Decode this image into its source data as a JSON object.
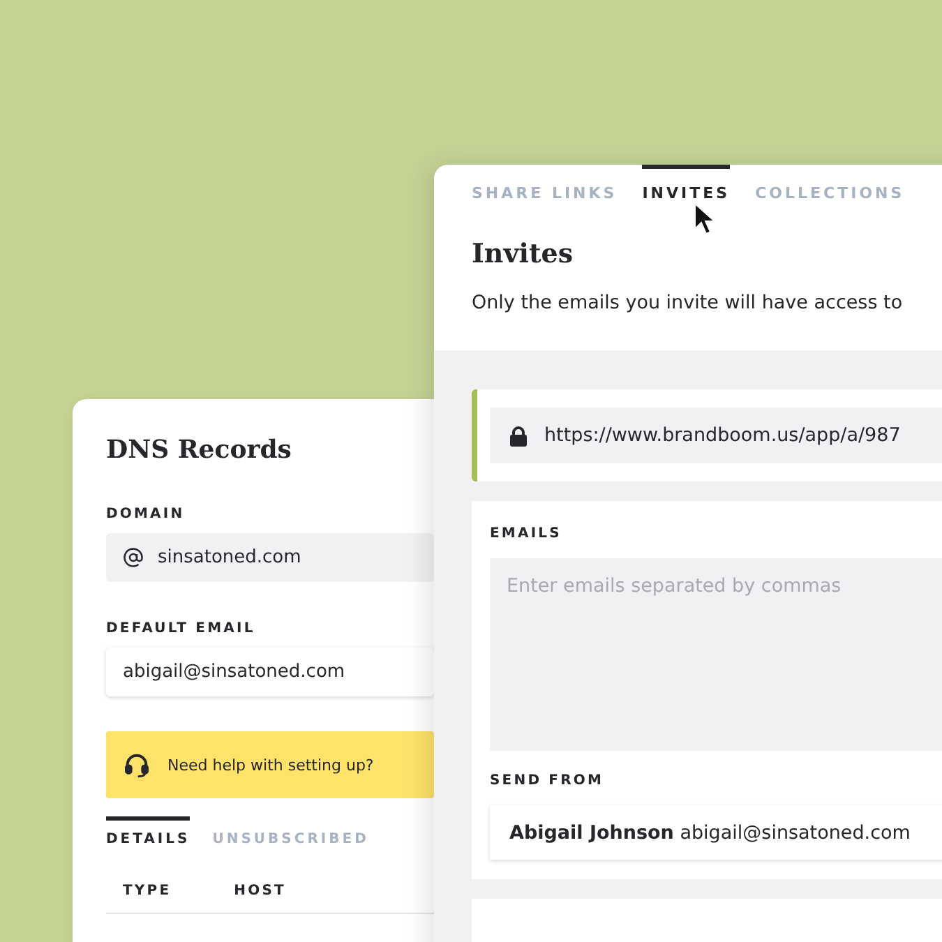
{
  "dns_card": {
    "title": "DNS Records",
    "domain": {
      "label": "DOMAIN",
      "value": "sinsatoned.com"
    },
    "default_email": {
      "label": "DEFAULT EMAIL",
      "value": "abigail@sinsatoned.com"
    },
    "help_banner": "Need help with setting up?",
    "tabs": [
      {
        "label": "DETAILS",
        "selected": true
      },
      {
        "label": "UNSUBSCRIBED",
        "selected": false
      }
    ],
    "table": {
      "columns": [
        "TYPE",
        "HOST"
      ]
    }
  },
  "share_card": {
    "tabs": [
      {
        "label": "SHARE LINKS",
        "selected": false
      },
      {
        "label": "INVITES",
        "selected": true
      },
      {
        "label": "COLLECTIONS",
        "selected": false
      }
    ],
    "title": "Invites",
    "description": "Only the emails you invite will have access to",
    "link": "https://www.brandboom.us/app/a/987",
    "emails": {
      "label": "EMAILS",
      "placeholder": "Enter emails separated by commas"
    },
    "send_from": {
      "label": "SEND FROM",
      "name": "Abigail Johnson",
      "email": "abigail@sinsatoned.com"
    }
  }
}
